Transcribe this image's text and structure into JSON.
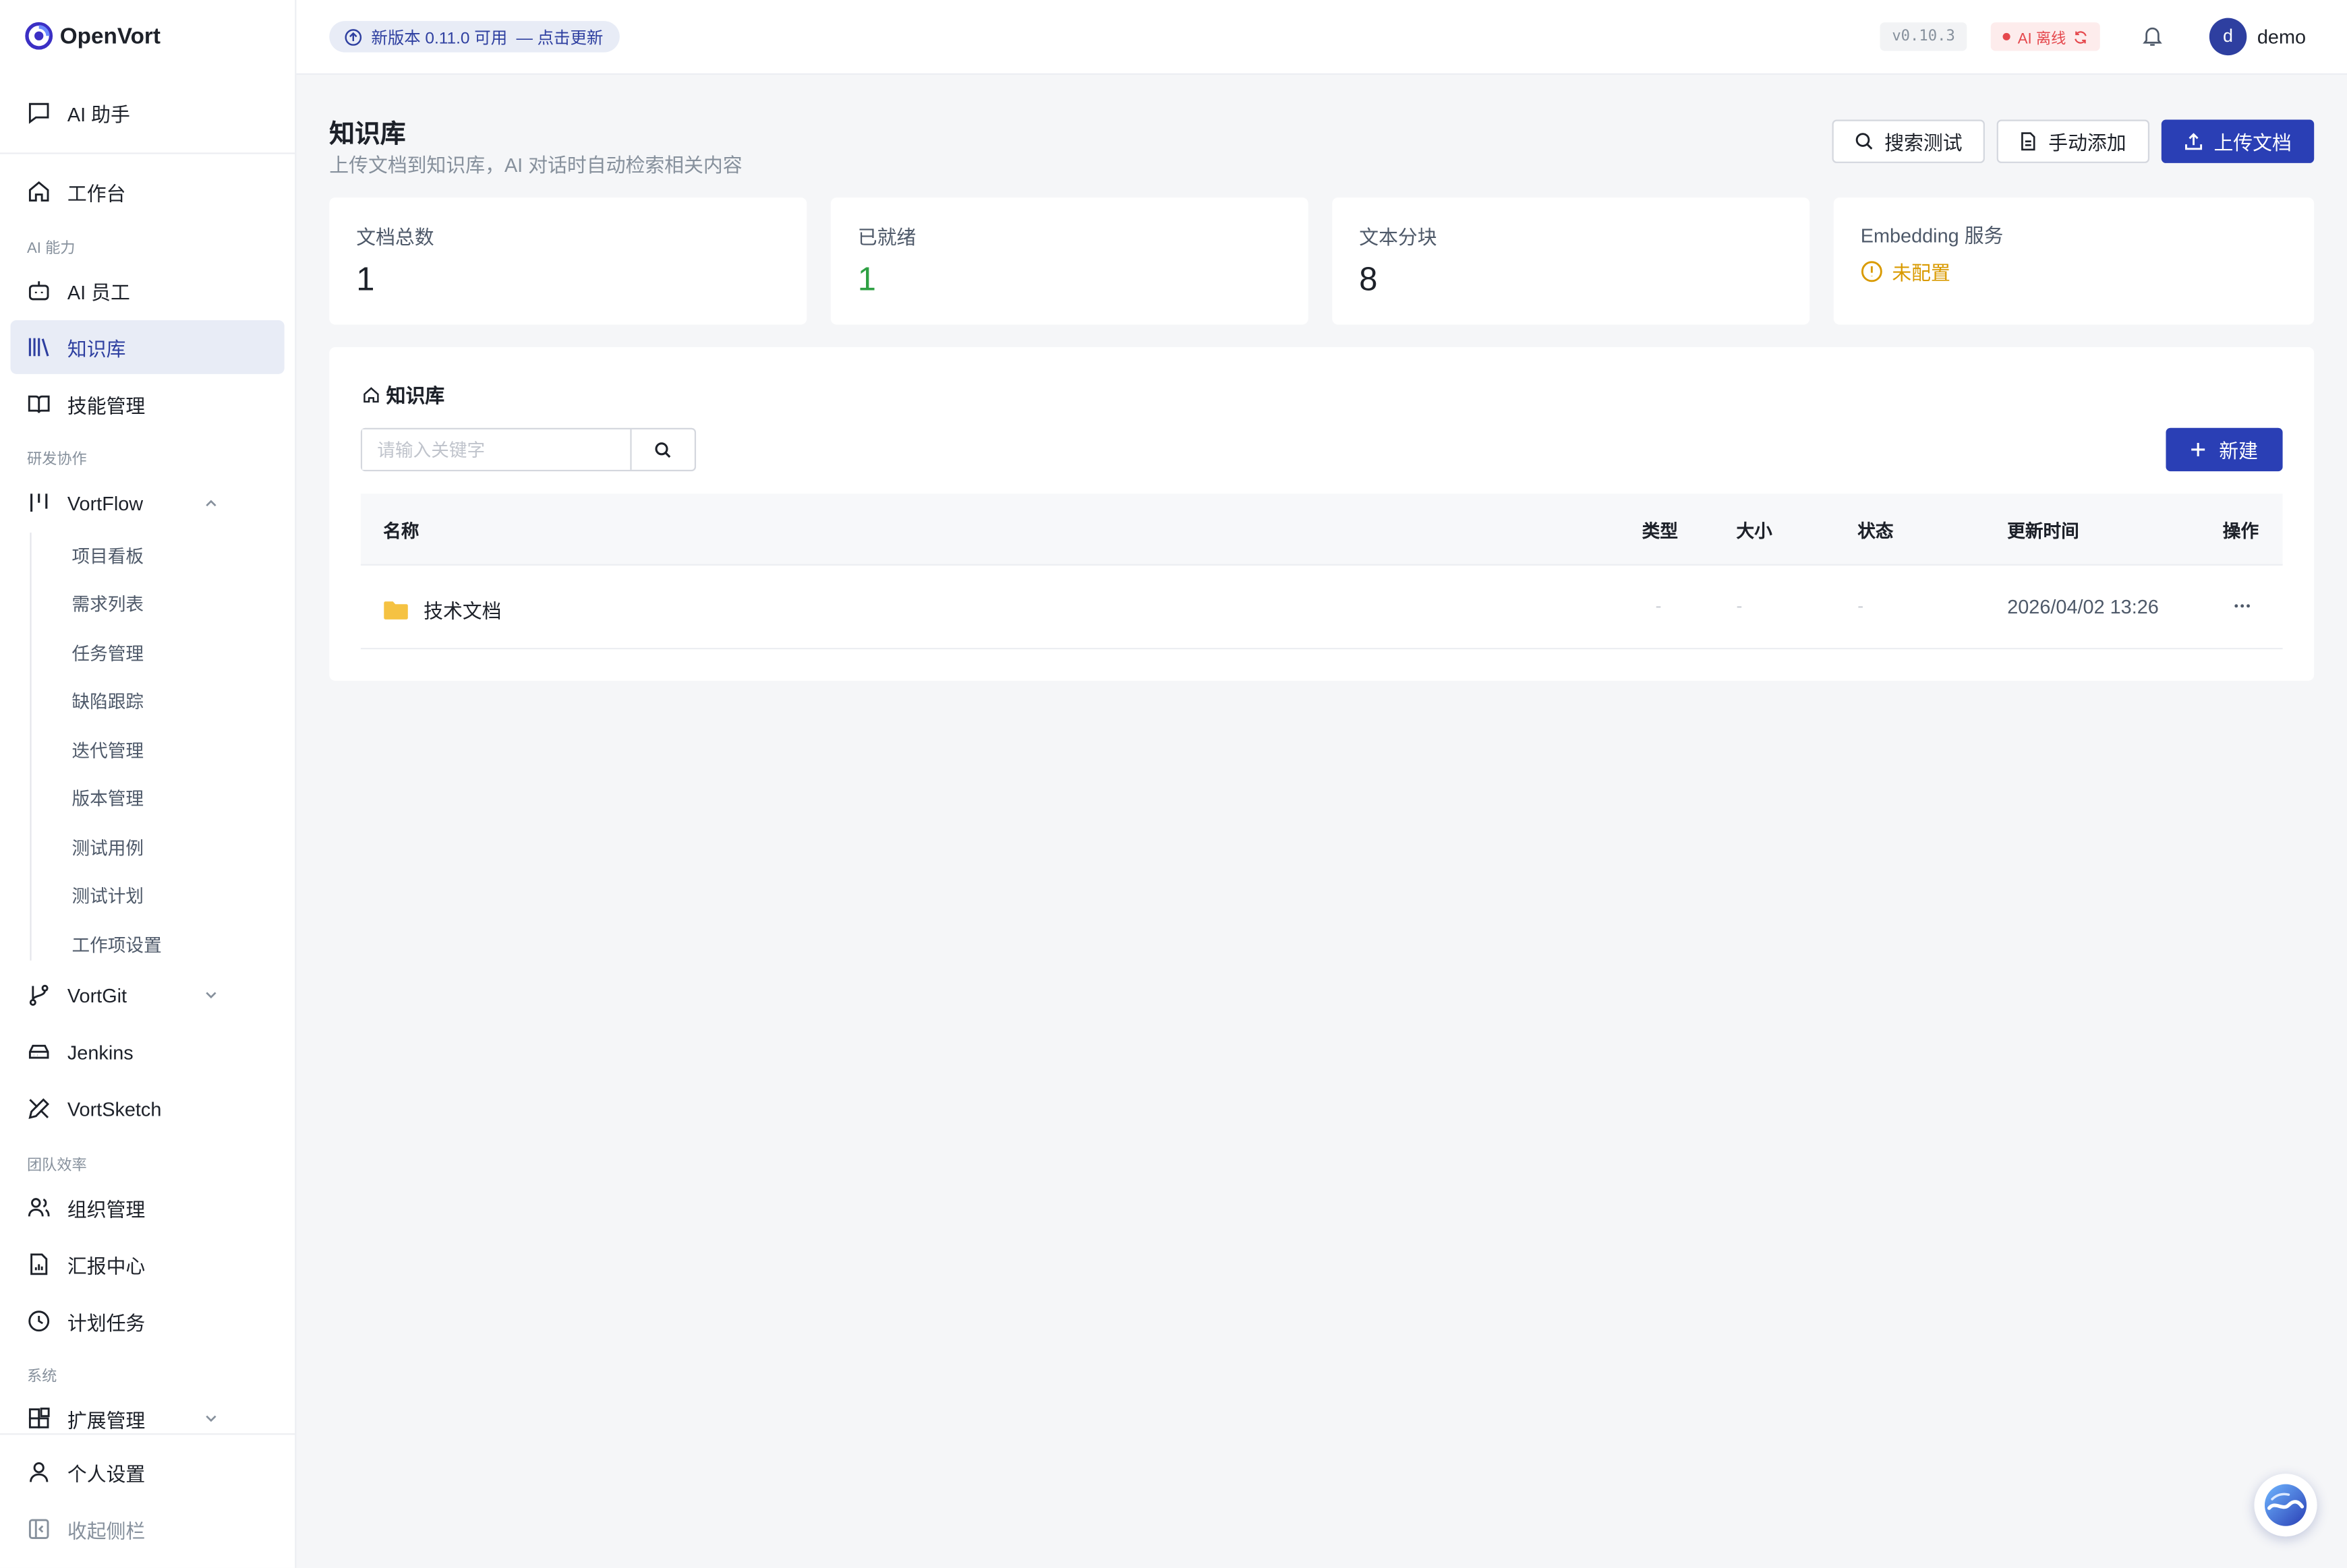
{
  "app": {
    "name": "OpenVort"
  },
  "sidebar": {
    "ai_assistant": "AI 助手",
    "workbench": "工作台",
    "section_ai": "AI 能力",
    "ai_staff": "AI 员工",
    "knowledge": "知识库",
    "skills": "技能管理",
    "section_dev": "研发协作",
    "vortflow": "VortFlow",
    "vortflow_items": [
      "项目看板",
      "需求列表",
      "任务管理",
      "缺陷跟踪",
      "迭代管理",
      "版本管理",
      "测试用例",
      "测试计划",
      "工作项设置"
    ],
    "vortgit": "VortGit",
    "jenkins": "Jenkins",
    "vortsketch": "VortSketch",
    "section_team": "团队效率",
    "org": "组织管理",
    "reports": "汇报中心",
    "schedule": "计划任务",
    "section_system": "系统",
    "extensions": "扩展管理",
    "profile": "个人设置",
    "collapse": "收起侧栏"
  },
  "topbar": {
    "update_text": "新版本 0.11.0 可用",
    "update_action": "— 点击更新",
    "version": "v0.10.3",
    "ai_status": "AI 离线",
    "avatar_letter": "d",
    "username": "demo"
  },
  "page": {
    "title": "知识库",
    "subtitle": "上传文档到知识库，AI 对话时自动检索相关内容",
    "btn_search_test": "搜索测试",
    "btn_manual_add": "手动添加",
    "btn_upload": "上传文档"
  },
  "stats": {
    "total_label": "文档总数",
    "total_value": "1",
    "ready_label": "已就绪",
    "ready_value": "1",
    "chunks_label": "文本分块",
    "chunks_value": "8",
    "embedding_label": "Embedding 服务",
    "embedding_status": "未配置"
  },
  "library": {
    "breadcrumb": "知识库",
    "search_placeholder": "请输入关键字",
    "new_button": "新建",
    "columns": {
      "name": "名称",
      "type": "类型",
      "size": "大小",
      "status": "状态",
      "updated": "更新时间",
      "actions": "操作"
    },
    "rows": [
      {
        "name": "技术文档",
        "type": "-",
        "size": "-",
        "status": "-",
        "updated": "2026/04/02 13:26"
      }
    ]
  },
  "colors": {
    "primary": "#2a3fb5",
    "success": "#2ea043",
    "warning": "#d99a00",
    "danger": "#e5484d",
    "folder": "#f5c242"
  }
}
